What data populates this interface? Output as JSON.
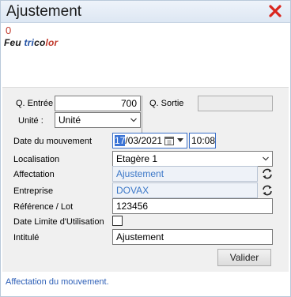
{
  "window": {
    "title": "Ajustement"
  },
  "header": {
    "counter": "0",
    "product_parts": [
      {
        "text": "Feu ",
        "color": "#1a1a1a"
      },
      {
        "text": "tri",
        "color": "#1f4fa3"
      },
      {
        "text": "co",
        "color": "#1a1a1a"
      },
      {
        "text": "l",
        "color": "#c0392b"
      },
      {
        "text": "or",
        "color": "#c0392b"
      }
    ]
  },
  "form": {
    "q_entree_label": "Q. Entrée",
    "q_entree_value": "700",
    "q_sortie_label": "Q. Sortie",
    "q_sortie_value": "",
    "unite_label": "Unité :",
    "unite_value": "Unité",
    "date_label": "Date du mouvement",
    "date_selected": "17",
    "date_rest": "/03/2021",
    "time_value": "10:08",
    "localisation_label": "Localisation",
    "localisation_value": "Etagère 1",
    "affectation_label": "Affectation",
    "affectation_value": "Ajustement",
    "entreprise_label": "Entreprise",
    "entreprise_value": "DOVAX",
    "reference_label": "Référence / Lot",
    "reference_value": "123456",
    "dlu_label": "Date Limite d'Utilisation",
    "dlu_checked": false,
    "intitule_label": "Intitulé",
    "intitule_value": "Ajustement",
    "valider_label": "Valider"
  },
  "status": {
    "text": "Affectation du mouvement."
  },
  "colors": {
    "close": "#d9251d",
    "accent": "#3b74d6",
    "status_text": "#2d5fb7"
  }
}
